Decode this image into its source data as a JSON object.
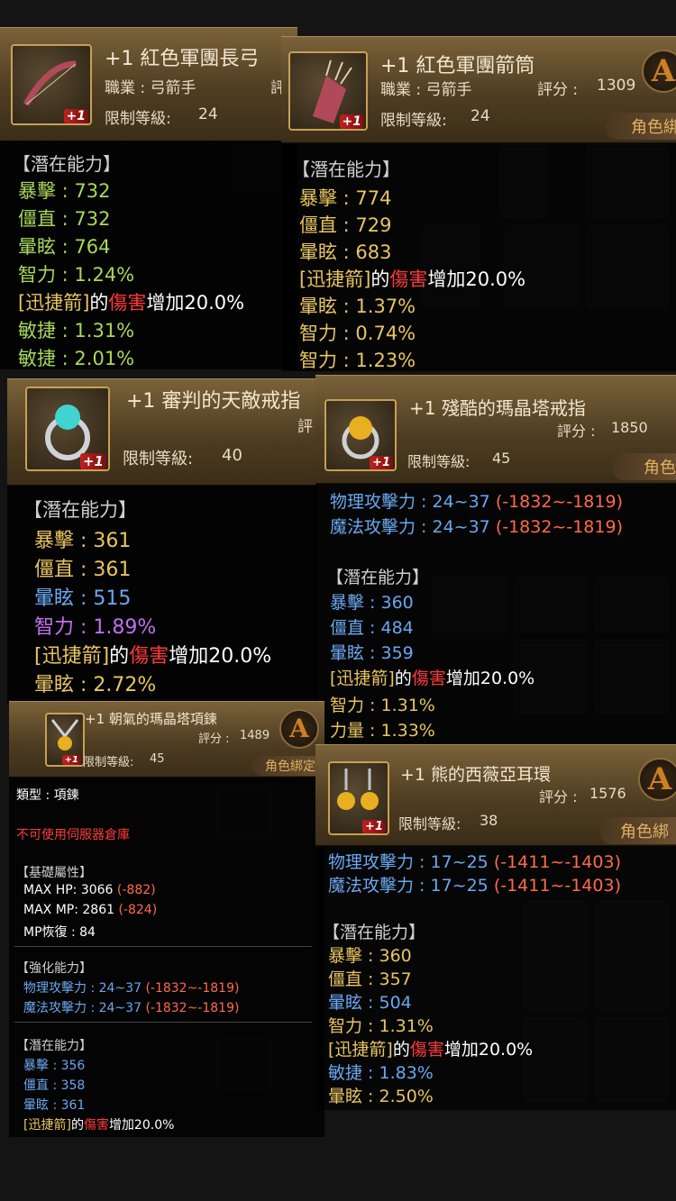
{
  "items": [
    {
      "name": "+1 紅色軍團長弓",
      "job": "職業 : 弓箭手",
      "score_label": "評",
      "level_label": "限制等級:",
      "level": "24",
      "icon": "bow-icon",
      "plus": "+1",
      "potential_header": "【潛在能力】",
      "stats": [
        "暴擊 : 732",
        "僵直 : 732",
        "暈眩 : 764",
        "智力 : 1.24%"
      ],
      "skill_bracket": "[迅捷箭]",
      "skill_de": "的",
      "skill_dmg": "傷害",
      "skill_inc": "增加20.0%",
      "stats2": [
        "敏捷 : 1.31%",
        "敏捷 : 2.01%"
      ]
    },
    {
      "name": "+1 紅色軍團箭筒",
      "job": "職業 : 弓箭手",
      "score_label": "評分 :",
      "score": "1309",
      "level_label": "限制等級:",
      "level": "24",
      "tag": "角色綁",
      "badge": "A",
      "icon": "quiver-icon",
      "plus": "+1",
      "potential_header": "【潛在能力】",
      "stats": [
        "暴擊 : 774",
        "僵直 : 729",
        "暈眩 : 683"
      ],
      "skill_bracket": "[迅捷箭]",
      "skill_de": "的",
      "skill_dmg": "傷害",
      "skill_inc": "增加20.0%",
      "stats2": [
        "暈眩 : 1.37%",
        "智力 : 0.74%",
        "智力 : 1.23%"
      ]
    },
    {
      "name": "+1 審判的天敵戒指",
      "score_label": "評",
      "level_label": "限制等級:",
      "level": "40",
      "icon": "ring-icon",
      "plus": "+1",
      "potential_header": "【潛在能力】",
      "stats": [
        "暴擊 : 361",
        "僵直 : 361",
        "暈眩 : 515",
        "智力 : 1.89%"
      ],
      "skill_bracket": "[迅捷箭]",
      "skill_de": "的",
      "skill_dmg": "傷害",
      "skill_inc": "增加20.0%",
      "stats2": [
        "暈眩 : 2.72%"
      ]
    },
    {
      "name": "+1 殘酷的瑪晶塔戒指",
      "score_label": "評分 :",
      "score": "1850",
      "level_label": "限制等級:",
      "level": "45",
      "tag": "角色",
      "icon": "ring-icon",
      "plus": "+1",
      "atk": [
        {
          "label": "物理攻擊力 : 24~37",
          "diff": "(-1832~-1819)"
        },
        {
          "label": "魔法攻擊力 : 24~37",
          "diff": "(-1832~-1819)"
        }
      ],
      "potential_header": "【潛在能力】",
      "stats": [
        "暴擊 : 360",
        "僵直 : 484",
        "暈眩 : 359"
      ],
      "skill_bracket": "[迅捷箭]",
      "skill_de": "的",
      "skill_dmg": "傷害",
      "skill_inc": "增加20.0%",
      "stats2": [
        "智力 : 1.31%",
        "力量 : 1.33%"
      ]
    },
    {
      "name": "+1 朝氣的瑪晶塔項鍊",
      "score_label": "評分 :",
      "score": "1489",
      "level_label": "限制等級:",
      "level": "45",
      "tag": "角色綁定",
      "badge": "A",
      "icon": "necklace-icon",
      "plus": "+1",
      "type_line": "類型 :   項鍊",
      "warn": "不可使用伺服器倉庫",
      "base_header": "【基礎屬性】",
      "base": [
        {
          "label": "MAX HP:   3066",
          "diff": "(-882)"
        },
        {
          "label": "MAX MP:   2861",
          "diff": "(-824)"
        },
        {
          "label": "MP恢復 : 84",
          "diff": ""
        }
      ],
      "enh_header": "【強化能力】",
      "atk": [
        {
          "label": "物理攻擊力 : 24~37",
          "diff": "(-1832~-1819)"
        },
        {
          "label": "魔法攻擊力 : 24~37",
          "diff": "(-1832~-1819)"
        }
      ],
      "potential_header": "【潛在能力】",
      "stats": [
        "暴擊 : 356",
        "僵直 : 358",
        "暈眩 : 361"
      ],
      "skill_bracket": "[迅捷箭]",
      "skill_de": "的",
      "skill_dmg": "傷害",
      "skill_inc": "增加20.0%"
    },
    {
      "name": "+1 熊的西薇亞耳環",
      "score_label": "評分 :",
      "score": "1576",
      "level_label": "限制等級:",
      "level": "38",
      "tag": "角色綁",
      "badge": "A",
      "icon": "earring-icon",
      "plus": "+1",
      "atk": [
        {
          "label": "物理攻擊力 : 17~25",
          "diff": "(-1411~-1403)"
        },
        {
          "label": "魔法攻擊力 : 17~25",
          "diff": "(-1411~-1403)"
        }
      ],
      "potential_header": "【潛在能力】",
      "stats": [
        "暴擊 : 360",
        "僵直 : 357",
        "暈眩 : 504",
        "智力 : 1.31%"
      ],
      "skill_bracket": "[迅捷箭]",
      "skill_de": "的",
      "skill_dmg": "傷害",
      "skill_inc": "增加20.0%",
      "stats2": [
        "敏捷 : 1.83%",
        "暈眩 : 2.50%"
      ]
    }
  ]
}
